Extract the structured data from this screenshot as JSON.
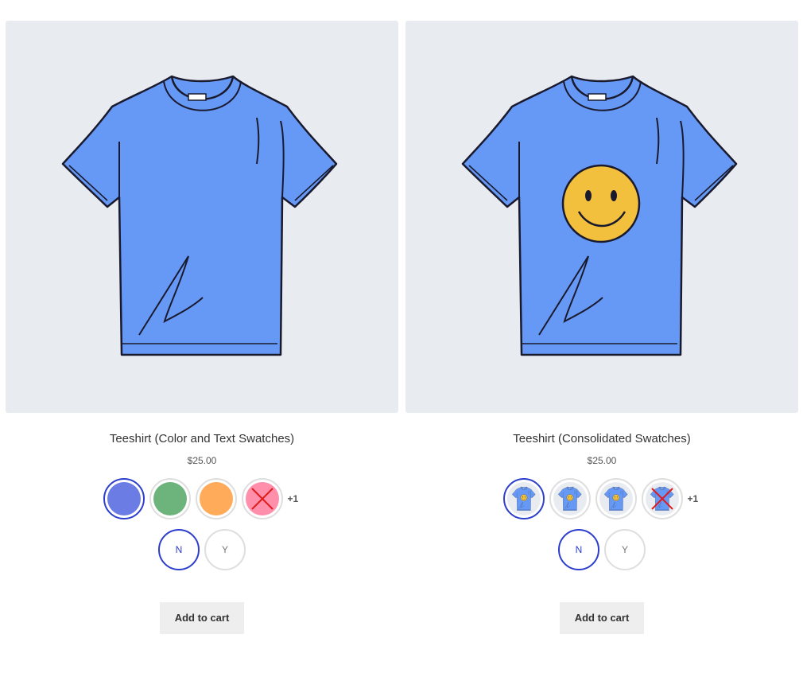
{
  "products": [
    {
      "title": "Teeshirt (Color and Text Swatches)",
      "price": "$25.00",
      "has_smiley": false,
      "swatch_type": "color",
      "swatches": [
        {
          "color": "#6b7de4",
          "selected": true,
          "unavailable": false
        },
        {
          "color": "#6db37c",
          "selected": false,
          "unavailable": false
        },
        {
          "color": "#ffab5a",
          "selected": false,
          "unavailable": false
        },
        {
          "color": "#ff8fab",
          "selected": false,
          "unavailable": true
        }
      ],
      "more_count": "+1",
      "text_swatches": [
        {
          "label": "N",
          "selected": true
        },
        {
          "label": "Y",
          "selected": false
        }
      ],
      "add_to_cart": "Add to cart"
    },
    {
      "title": "Teeshirt (Consolidated Swatches)",
      "price": "$25.00",
      "has_smiley": true,
      "swatch_type": "image",
      "swatches": [
        {
          "image": "teeshirt-smiley-icon",
          "selected": true,
          "unavailable": false
        },
        {
          "image": "teeshirt-smiley-icon",
          "selected": false,
          "unavailable": false
        },
        {
          "image": "teeshirt-smiley-icon",
          "selected": false,
          "unavailable": false
        },
        {
          "image": "teeshirt-icon",
          "selected": false,
          "unavailable": true
        }
      ],
      "more_count": "+1",
      "text_swatches": [
        {
          "label": "N",
          "selected": true
        },
        {
          "label": "Y",
          "selected": false
        }
      ],
      "add_to_cart": "Add to cart"
    }
  ],
  "colors": {
    "shirt": "#6699f5",
    "shirt_outline": "#1a1a2e",
    "image_bg": "#e8ecf0",
    "smiley": "#f2c03d",
    "accent": "#2c3ecb"
  }
}
